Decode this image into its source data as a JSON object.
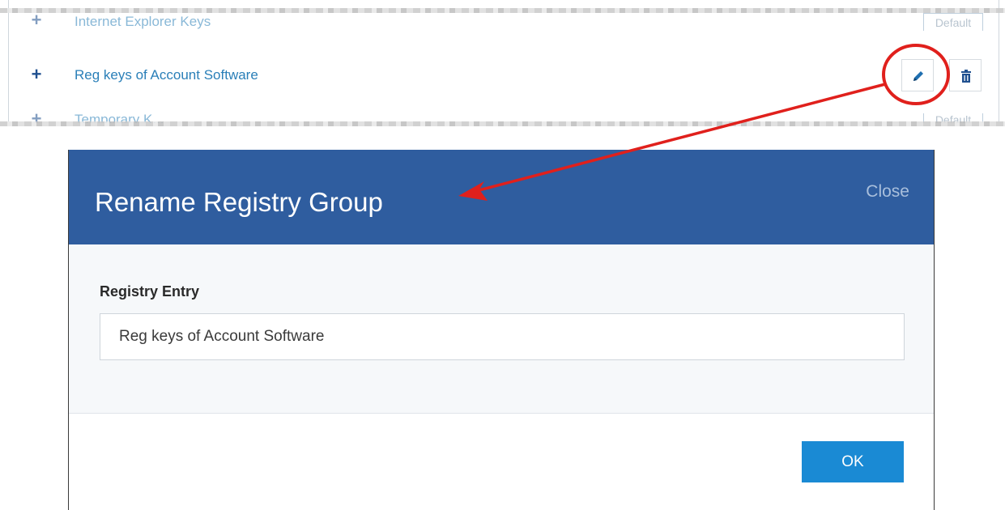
{
  "list": {
    "rows": [
      {
        "label": "Internet Explorer Keys",
        "tag": "Default"
      },
      {
        "label": "Reg keys of Account Software",
        "tag": ""
      },
      {
        "label": "Temporary K...",
        "tag": "Default"
      }
    ],
    "actions": {
      "edit_icon": "pencil-icon",
      "delete_icon": "trash-icon"
    }
  },
  "dialog": {
    "title": "Rename Registry Group",
    "close_label": "Close",
    "field_label": "Registry Entry",
    "field_value": "Reg keys of Account Software",
    "ok_label": "OK"
  },
  "colors": {
    "header": "#2f5d9f",
    "ok_button": "#1a8ad4",
    "link": "#2a7fb8",
    "annotation": "#e0201c"
  }
}
